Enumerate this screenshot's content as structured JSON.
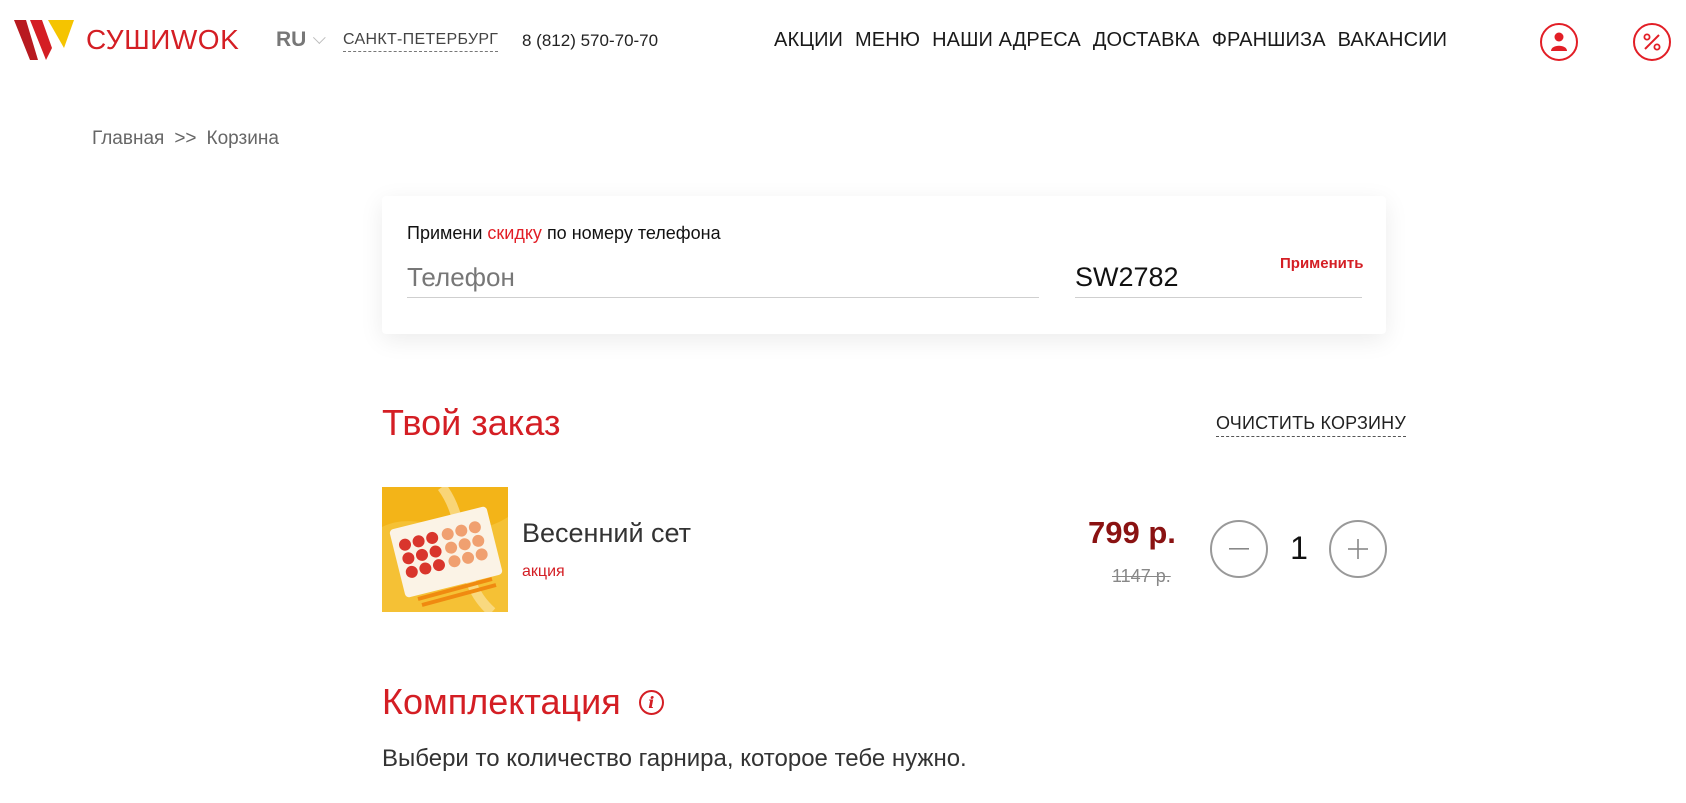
{
  "header": {
    "logo_text": "СУШИWOK",
    "lang": "RU",
    "city": "САНКТ-ПЕТЕРБУРГ",
    "phone": "8 (812) 570-70-70",
    "nav": [
      "АКЦИИ",
      "МЕНЮ",
      "НАШИ АДРЕСА",
      "ДОСТАВКА",
      "ФРАНШИЗА",
      "ВАКАНСИИ"
    ],
    "icons": [
      "user-icon",
      "percent-icon"
    ]
  },
  "breadcrumb": {
    "home": "Главная",
    "separator": ">>",
    "current": "Корзина"
  },
  "promo": {
    "title_before": "Примени",
    "title_accent": "скидку",
    "title_after": "по номеру телефона",
    "phone_placeholder": "Телефон",
    "phone_value": "",
    "code_value": "SW2782",
    "apply_label": "Применить"
  },
  "order": {
    "title": "Твой заказ",
    "clear_label": "ОЧИСТИТЬ КОРЗИНУ",
    "items": [
      {
        "name": "Весенний сет",
        "tag": "акция",
        "price": "799 р.",
        "old_price": "1147 р.",
        "quantity": "1"
      }
    ]
  },
  "komplekt": {
    "title": "Комплектация",
    "info_icon": "i",
    "description": "Выбери то количество гарнира, которое тебе нужно."
  },
  "colors": {
    "brand_red": "#d41e24",
    "price_dark_red": "#8a1212",
    "logo_yellow": "#f5c400"
  }
}
